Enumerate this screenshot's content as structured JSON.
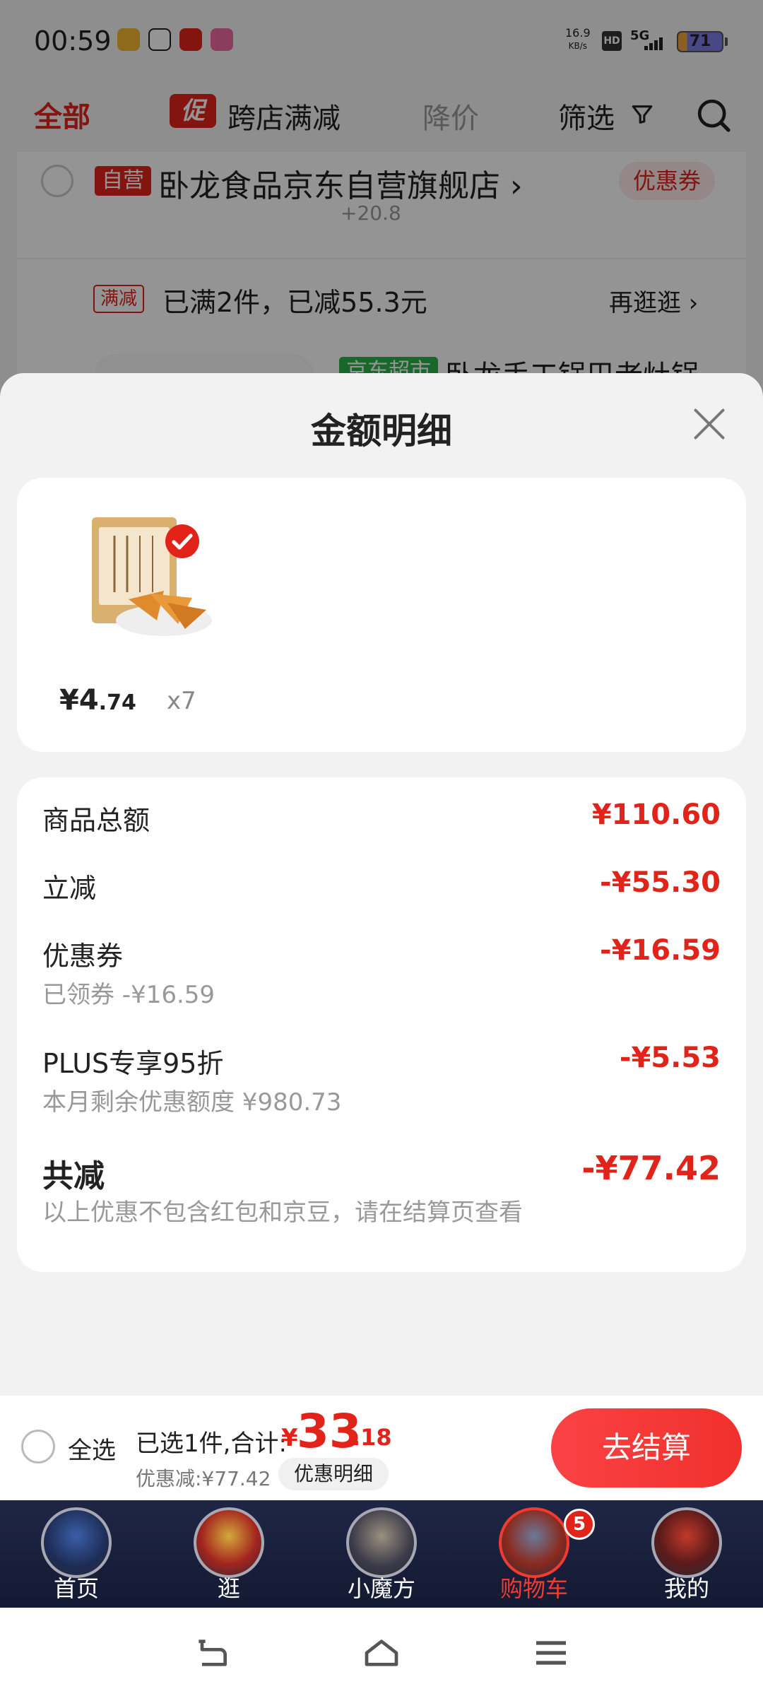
{
  "status_bar": {
    "time": "00:59",
    "net_speed_value": "16.9",
    "net_speed_unit": "KB/s",
    "hd": "HD",
    "network": "5G",
    "battery": "71"
  },
  "tabs": {
    "all": "全部",
    "promo_badge": "促",
    "cross_shop": "跨店满减",
    "price_drop": "降价",
    "filter": "筛选"
  },
  "shop": {
    "self_badge": "自营",
    "name": "卧龙食品京东自营旗舰店 ›",
    "coupon_chip": "优惠券",
    "extra_text": "+20.8",
    "promo_badge": "满减",
    "promo_text": "已满2件，已减55.3元",
    "go_shopping": "再逛逛 ›",
    "product_tag": "京东超市",
    "product_title": "卧龙手工锅巴老灶锅"
  },
  "sheet": {
    "title": "金额明细",
    "product": {
      "price_main": "¥4",
      "price_decimal": ".74",
      "quantity": "x7"
    },
    "rows": [
      {
        "label": "商品总额",
        "sub": "",
        "value": "¥110.60"
      },
      {
        "label": "立减",
        "sub": "",
        "value": "-¥55.30"
      },
      {
        "label": "优惠券",
        "sub": "已领券 -¥16.59",
        "value": "-¥16.59"
      },
      {
        "label": "PLUS专享95折",
        "sub": "本月剩余优惠额度 ¥980.73",
        "value": "-¥5.53"
      }
    ],
    "total": {
      "label": "共减",
      "note": "以上优惠不包含红包和京豆，请在结算页查看",
      "value": "-¥77.42"
    }
  },
  "checkout": {
    "select_all": "全选",
    "selected_summary": "已选1件,合计:",
    "currency": "¥",
    "total_integer": "33",
    "total_decimal": ".18",
    "discount_line": "优惠减:¥77.42",
    "detail_chip": "优惠明细",
    "checkout_button": "去结算"
  },
  "bottom_nav": {
    "items": [
      {
        "label": "首页"
      },
      {
        "label": "逛"
      },
      {
        "label": "小魔方"
      },
      {
        "label": "购物车",
        "badge": "5"
      },
      {
        "label": "我的"
      }
    ]
  },
  "colors": {
    "brand_red": "#e2231a",
    "nav_background": "#1a2040"
  }
}
